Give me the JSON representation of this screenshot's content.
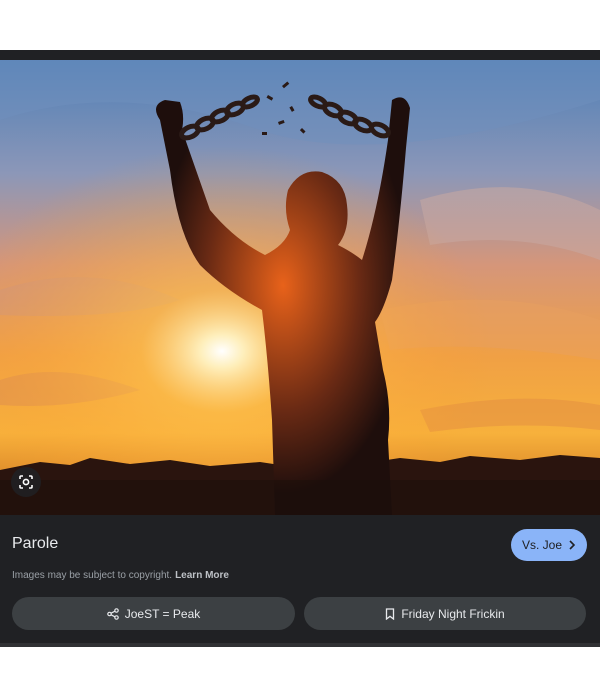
{
  "result": {
    "title": "Parole",
    "visit_label": "Vs. Joe",
    "visit_icon": "chevron-right-icon",
    "copyright_text": "Images may be subject to copyright.",
    "learn_more_label": "Learn More"
  },
  "actions": {
    "share_label": "JoeST = Peak",
    "share_icon": "share-icon",
    "save_label": "Friday Night Frickin",
    "save_icon": "bookmark-icon"
  },
  "image": {
    "lens_icon": "lens-icon"
  },
  "colors": {
    "panel_bg": "#202124",
    "button_bg": "#3c4043",
    "accent": "#8ab4f8",
    "text_primary": "#e8eaed",
    "text_secondary": "#9aa0a6"
  }
}
